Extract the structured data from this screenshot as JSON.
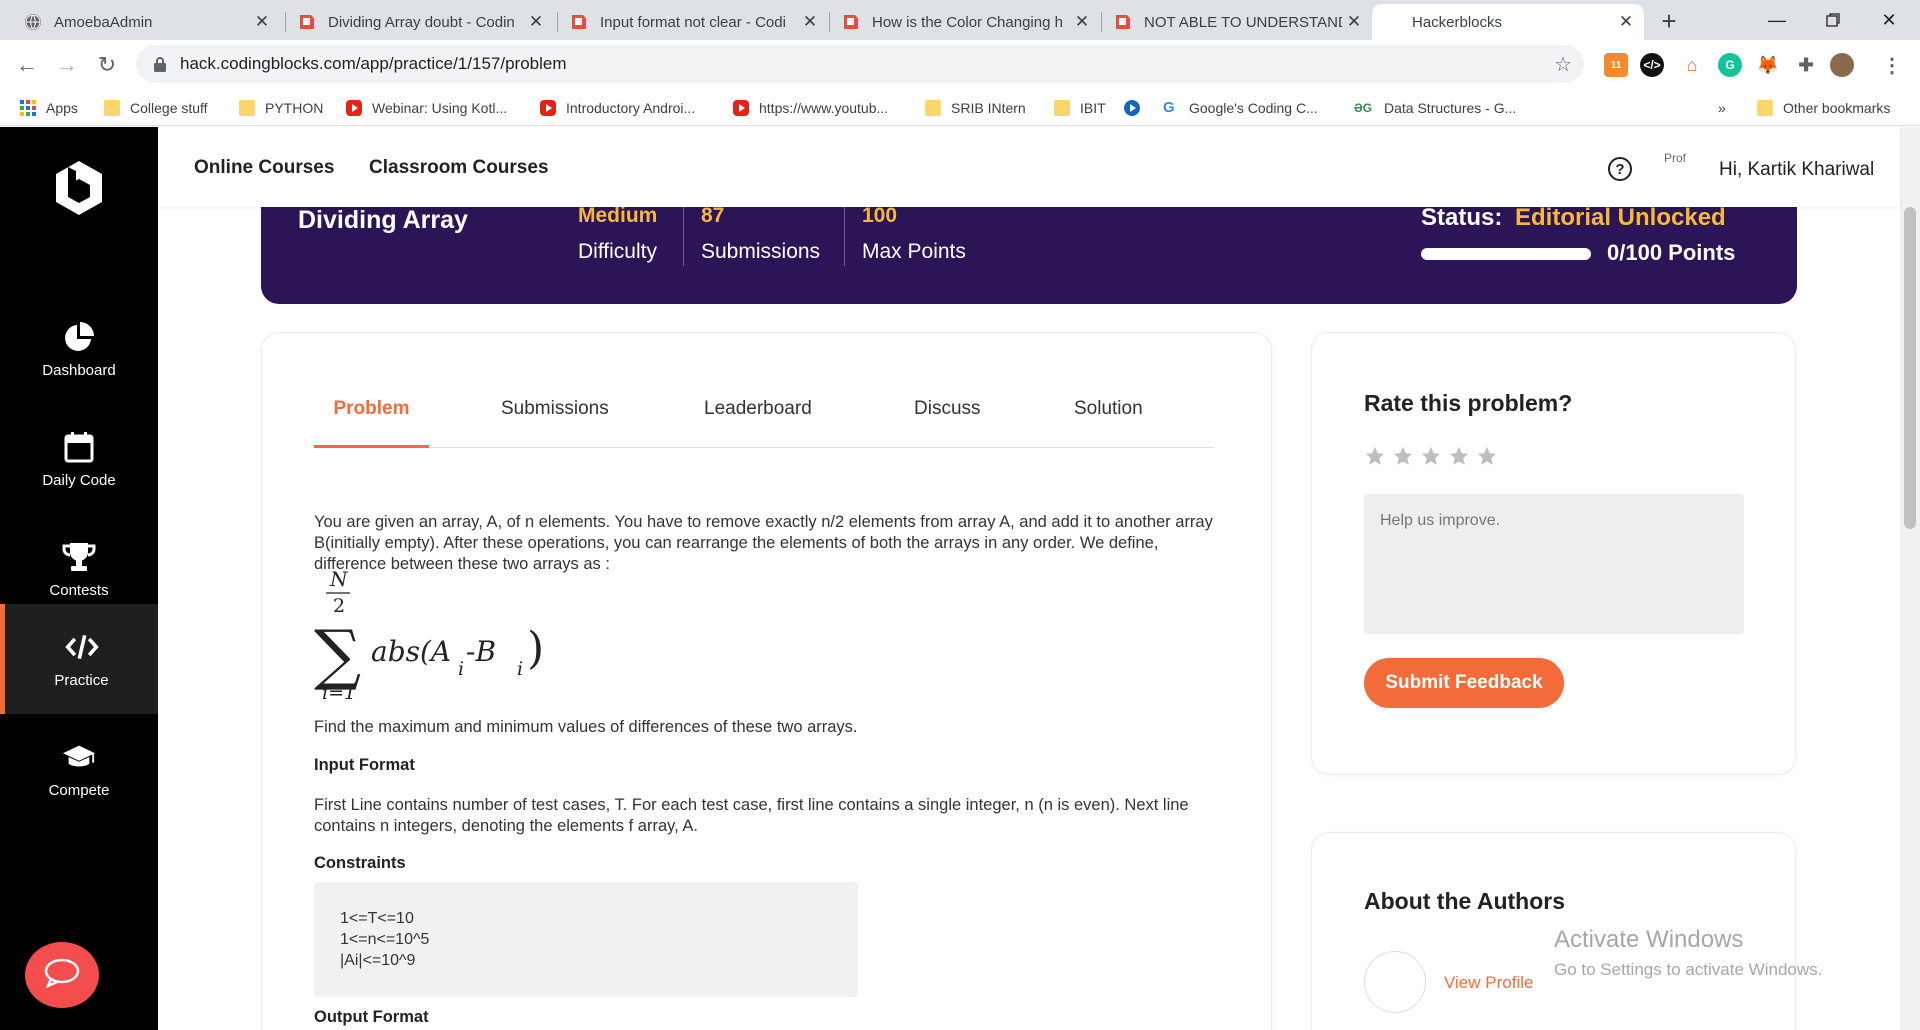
{
  "browser": {
    "tabs": [
      {
        "title": "AmoebaAdmin",
        "active": false
      },
      {
        "title": "Dividing Array doubt - Codin",
        "active": false
      },
      {
        "title": "Input format not clear - Codi",
        "active": false
      },
      {
        "title": "How is the Color Changing h",
        "active": false
      },
      {
        "title": "NOT ABLE TO UNDERSTAND",
        "active": false
      },
      {
        "title": "Hackerblocks",
        "active": true
      }
    ],
    "url": "hack.codingblocks.com/app/practice/1/157/problem",
    "ext_badge": "11",
    "bookmarks": [
      {
        "label": "Apps",
        "icon": "apps-grid-icon"
      },
      {
        "label": "College stuff",
        "icon": "folder-icon"
      },
      {
        "label": "PYTHON",
        "icon": "folder-icon"
      },
      {
        "label": "Webinar: Using Kotl...",
        "icon": "youtube-icon"
      },
      {
        "label": "Introductory Androi...",
        "icon": "youtube-icon"
      },
      {
        "label": "https://www.youtub...",
        "icon": "youtube-icon"
      },
      {
        "label": "SRIB INtern",
        "icon": "folder-icon"
      },
      {
        "label": "IBIT",
        "icon": "folder-icon"
      },
      {
        "label": "",
        "icon": "play-circle-icon"
      },
      {
        "label": "Google's Coding C...",
        "icon": "google-icon"
      },
      {
        "label": "Data Structures - G...",
        "icon": "gfg-icon"
      }
    ],
    "bookmarks_overflow": "»",
    "other_bookmarks": "Other bookmarks"
  },
  "sidebar": {
    "items": [
      {
        "label": "Dashboard",
        "icon": "pie-chart-icon"
      },
      {
        "label": "Daily Code",
        "icon": "calendar-icon"
      },
      {
        "label": "Contests",
        "icon": "trophy-icon"
      },
      {
        "label": "Practice",
        "icon": "code-icon",
        "active": true
      },
      {
        "label": "Compete",
        "icon": "graduation-cap-icon"
      }
    ]
  },
  "nav": {
    "links": [
      "Online Courses",
      "Classroom Courses"
    ],
    "help": "?",
    "avatar_alt": "Prof",
    "greeting": "Hi, Kartik Khariwal"
  },
  "banner": {
    "problem_name": "Dividing Array",
    "stats": [
      {
        "value": "Medium",
        "label": "Difficulty"
      },
      {
        "value": "87",
        "label": "Submissions"
      },
      {
        "value": "100",
        "label": "Max Points"
      }
    ],
    "status_label": "Status:",
    "status_value": "Editorial Unlocked",
    "progress": 1.0,
    "points": "0/100 Points"
  },
  "problem": {
    "tabs": [
      "Problem",
      "Submissions",
      "Leaderboard",
      "Discuss",
      "Solution"
    ],
    "active_tab": "Problem",
    "description": "You are given an array, A, of n elements. You have to remove exactly n/2 elements from array A, and add it to another array B(initially empty). After these operations, you can rearrange the elements of both the arrays in any order. We define, difference between these two arrays as :",
    "formula": {
      "upper_num": "N",
      "upper_den": "2",
      "lower": "i=1",
      "body": "abs(A",
      "sub_a": "i",
      "mid": "-B",
      "sub_b": "i"
    },
    "find_text": "Find the maximum and minimum values of differences of these two arrays.",
    "input_heading": "Input Format",
    "input_text": "First Line contains number of test cases, T. For each test case, first line contains a single integer, n (n is even). Next line contains n integers, denoting the elements f array, A.",
    "constraints_heading": "Constraints",
    "constraints": [
      "1<=T<=10",
      "1<=n<=10^5",
      "|Ai|<=10^9"
    ],
    "output_heading": "Output Format"
  },
  "rating": {
    "title": "Rate this problem?",
    "stars": 0,
    "max_stars": 5,
    "placeholder": "Help us improve.",
    "submit_label": "Submit Feedback"
  },
  "authors": {
    "title": "About the Authors",
    "view_profile": "View Profile"
  },
  "watermark": {
    "line1": "Activate Windows",
    "line2": "Go to Settings to activate Windows."
  },
  "colors": {
    "accent": "#f26b38",
    "banner_bg": "#2b1556",
    "banner_highlight": "#f6b93b",
    "sidebar_bg": "#000000",
    "chat_button": "#f44d4d"
  }
}
